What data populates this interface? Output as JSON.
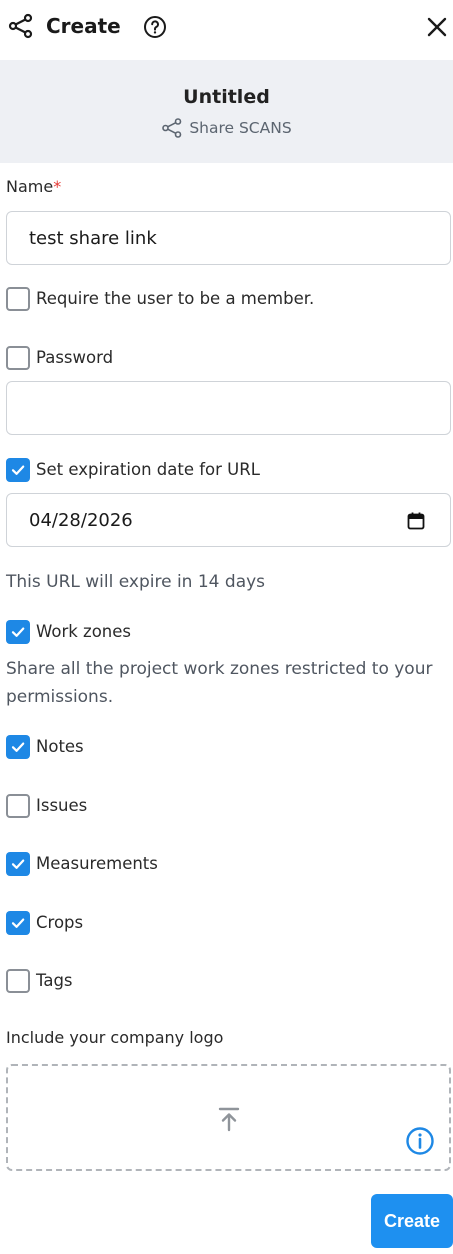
{
  "header": {
    "title": "Create",
    "icons": {
      "share": "share-icon",
      "help": "help-icon",
      "close": "close-icon"
    }
  },
  "banner": {
    "title": "Untitled",
    "subtitle": "Share SCANS"
  },
  "form": {
    "name_label": "Name",
    "required_mark": "*",
    "name_value": "test share link",
    "require_member_label": "Require the user to be a member.",
    "require_member_checked": false,
    "password_label": "Password",
    "password_checked": false,
    "password_value": "",
    "expiration_label": "Set expiration date for URL",
    "expiration_checked": true,
    "expiration_date": "04/28/2026",
    "expiration_note": "This URL will expire in 14 days",
    "work_zones_label": "Work zones",
    "work_zones_checked": true,
    "work_zones_note": "Share all the project work zones restricted to your permissions.",
    "options": [
      {
        "label": "Notes",
        "checked": true
      },
      {
        "label": "Issues",
        "checked": false
      },
      {
        "label": "Measurements",
        "checked": true
      },
      {
        "label": "Crops",
        "checked": true
      },
      {
        "label": "Tags",
        "checked": false
      }
    ],
    "logo_label": "Include your company logo"
  },
  "actions": {
    "create_label": "Create"
  },
  "colors": {
    "accent": "#1e88e5",
    "button": "#1e90f0",
    "banner_bg": "#eef0f4",
    "required": "#e53935"
  }
}
